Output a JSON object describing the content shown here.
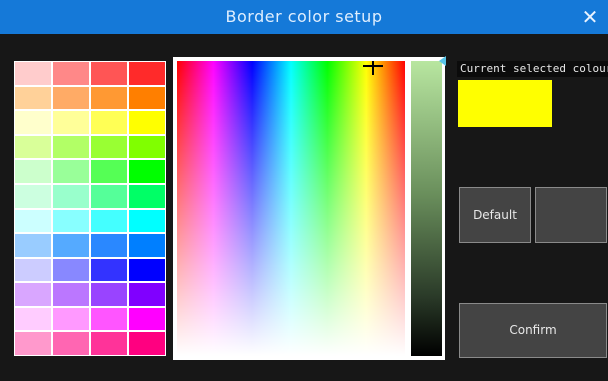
{
  "window": {
    "title": "Border color setup",
    "close_glyph": "✕"
  },
  "swatches": [
    [
      "#ffcccc",
      "#ff8888",
      "#ff5555",
      "#ff2a2a"
    ],
    [
      "#ffd199",
      "#ffab66",
      "#ff9933",
      "#ff7f00"
    ],
    [
      "#ffffcc",
      "#ffff99",
      "#ffff55",
      "#ffff00"
    ],
    [
      "#d9ff99",
      "#b2ff66",
      "#99ff33",
      "#80ff00"
    ],
    [
      "#ccffcc",
      "#99ff99",
      "#55ff55",
      "#00ff00"
    ],
    [
      "#ccffe0",
      "#99ffcc",
      "#55ff99",
      "#00ff66"
    ],
    [
      "#ccffff",
      "#88ffff",
      "#44ffff",
      "#00ffff"
    ],
    [
      "#99ccff",
      "#55aaff",
      "#2a88ff",
      "#007fff"
    ],
    [
      "#ccccff",
      "#8888ff",
      "#3333ff",
      "#0000ff"
    ],
    [
      "#d9a6ff",
      "#bb77ff",
      "#9944ff",
      "#8000ff"
    ],
    [
      "#ffccff",
      "#ff99ff",
      "#ff55ff",
      "#ff00ff"
    ],
    [
      "#ff99cc",
      "#ff66b2",
      "#ff3399",
      "#ff0080"
    ]
  ],
  "picker": {
    "crosshair_hue": "#ffff00",
    "brightness_level": 1.0
  },
  "current": {
    "label": "Current selected colour:",
    "color": "#ffff00"
  },
  "buttons": {
    "default_label": "Default",
    "blank_label": "",
    "confirm_label": "Confirm"
  }
}
